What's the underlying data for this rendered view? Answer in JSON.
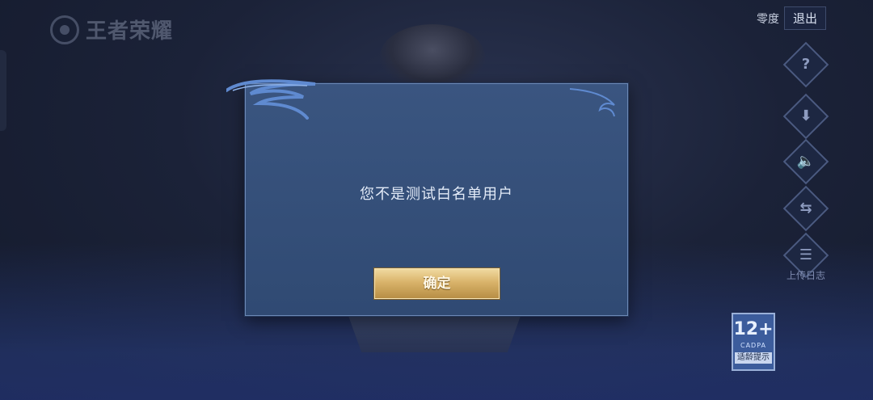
{
  "app": {
    "logo_text": "王者荣耀"
  },
  "header": {
    "account": "零度",
    "logout_label": "退出"
  },
  "sidebar": {
    "icons": [
      {
        "name": "help-icon",
        "glyph": "?"
      },
      {
        "name": "download-icon",
        "glyph": "⬇"
      },
      {
        "name": "sound-icon",
        "glyph": "🔈"
      },
      {
        "name": "account-switch-icon",
        "glyph": "⇆"
      },
      {
        "name": "log-icon",
        "glyph": "☰"
      }
    ],
    "upload_log_label": "上传日志"
  },
  "dialog": {
    "message": "您不是测试白名单用户",
    "confirm_label": "确定"
  },
  "age_rating": {
    "number": "12+",
    "org": "CADPA",
    "tip": "适龄提示"
  },
  "colors": {
    "dialog_bg": "#304a73",
    "button_gold": "#d9b36a",
    "background": "#1b2238"
  }
}
